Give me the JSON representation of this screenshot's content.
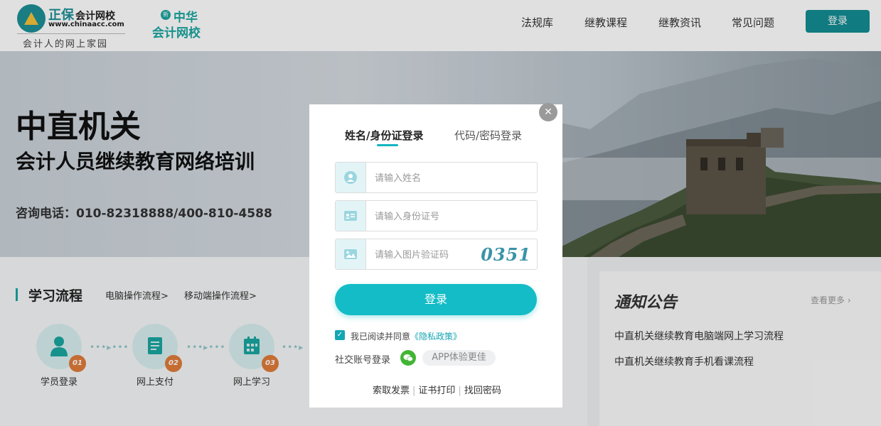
{
  "header": {
    "logo_brand": "正保",
    "logo_brand_suffix": "会计网校",
    "logo_url": "www.chinaacc.com",
    "logo_slogan": "会计人的网上家园",
    "logo2_line1": "中华",
    "logo2_line2": "会计网校",
    "nav": [
      "法规库",
      "继教课程",
      "继教资讯",
      "常见问题"
    ],
    "login_label": "登录"
  },
  "banner": {
    "title": "中直机关",
    "subtitle": "会计人员继续教育网络培训",
    "phone": "咨询电话：010-82318888/400-810-4588"
  },
  "learning": {
    "title": "学习流程",
    "links": [
      "电脑操作流程>",
      "移动端操作流程>"
    ],
    "steps": [
      {
        "label": "学员登录",
        "num": "01"
      },
      {
        "label": "网上支付",
        "num": "02"
      },
      {
        "label": "网上学习",
        "num": "03"
      }
    ]
  },
  "notice": {
    "title": "通知公告",
    "more": "查看更多",
    "items": [
      "中直机关继续教育电脑端网上学习流程",
      "中直机关继续教育手机看课流程"
    ]
  },
  "modal": {
    "tabs": [
      "姓名/身份证登录",
      "代码/密码登录"
    ],
    "active_tab": 0,
    "fields": {
      "name_placeholder": "请输入姓名",
      "id_placeholder": "请输入身份证号",
      "captcha_placeholder": "请输入图片验证码",
      "captcha_code": "0351"
    },
    "submit_label": "登录",
    "agree_text": "我已阅读并同意",
    "agree_link": "《隐私政策》",
    "agree_checked": true,
    "social_label": "社交账号登录",
    "app_label": "APP体验更佳",
    "bottom_links": [
      "索取发票",
      "证书打印",
      "找回密码"
    ]
  },
  "colors": {
    "accent": "#13bcc6",
    "header_button": "#138c92",
    "step_badge": "#e07b39",
    "wechat": "#43b535"
  }
}
